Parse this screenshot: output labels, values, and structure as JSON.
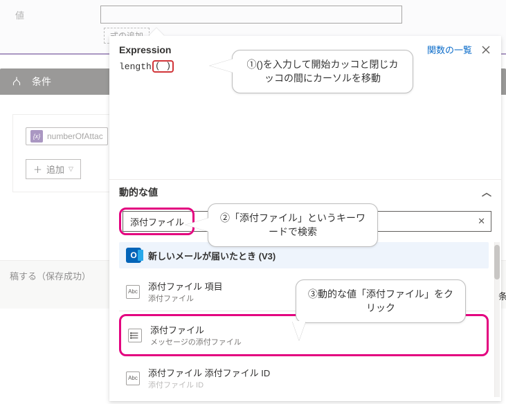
{
  "bg": {
    "value_label": "値",
    "add_expression": "式の追加",
    "condition_title": "条件",
    "token_label": "numberOfAttac",
    "token_icon_text": "{x}",
    "add_button": "追加",
    "post_title": "稿する（保存成功）"
  },
  "panel": {
    "title": "Expression",
    "functions_link": "関数の一覧",
    "expr_prefix": "length",
    "expr_parens": "( )",
    "dynamic_header": "動的な値",
    "search_value": "添付ファイル",
    "group_title": "新しいメールが届いたとき (V3)",
    "items": [
      {
        "name": "添付ファイル 項目",
        "desc": "添付ファイル",
        "icon": "abc"
      },
      {
        "name": "添付ファイル",
        "desc": "メッセージの添付ファイル",
        "icon": "list",
        "highlight": true
      },
      {
        "name": "添付ファイル 添付ファイル ID",
        "desc": "添付ファイル ID",
        "icon": "abc"
      }
    ]
  },
  "callouts": {
    "c1": "①()を入力して開始カッコと閉じカッコの間にカーソルを移動",
    "c2": "②「添付ファイル」というキーワードで検索",
    "c3": "③動的な値「添付ファイル」をクリック"
  },
  "side_text": "条"
}
